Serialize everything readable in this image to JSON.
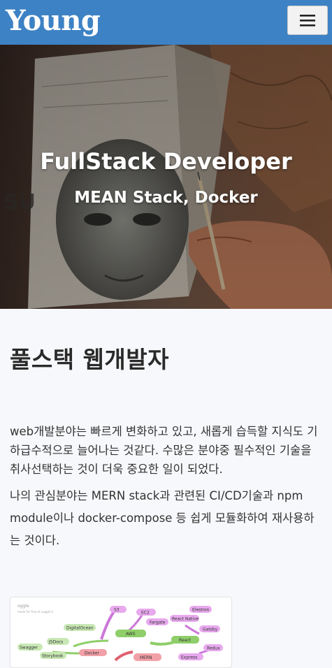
{
  "navbar": {
    "brand": "Young",
    "menu_icon": "hamburger-menu-icon"
  },
  "hero": {
    "title": "FullStack Developer",
    "subtitle": "MEAN Stack, Docker"
  },
  "main": {
    "section_title": "풀스택 웹개발자",
    "paragraph1": "web개발분야는 빠르게 변화하고 있고, 새롭게 습득할 지식도 기하급수적으로 늘어나는 것같다. 수많은 분야중 필수적인 기술을 취사선택하는 것이 더욱 중요한 일이 되었다.",
    "paragraph2": "나의 관심분야는 MERN stack과 관련된 CI/CD기술과 npm module이나 docker-compose 등 쉽게 모듈화하여 재사용하는 것이다."
  },
  "diagram": {
    "header_line1": "oggle",
    "header_line2": "made for free at coggle.it",
    "nodes": [
      "S3",
      "EC2",
      "Fargate",
      "AWS",
      "DigitalOcean",
      "Elestron",
      "React Native",
      "Gatsby",
      "React",
      "Redux",
      "JSDocs",
      "Swagger",
      "Storybook",
      "Docker",
      "MERN",
      "Express"
    ]
  },
  "colors": {
    "navbar": "#3d82c4",
    "body_bg": "#f7f8fb"
  }
}
